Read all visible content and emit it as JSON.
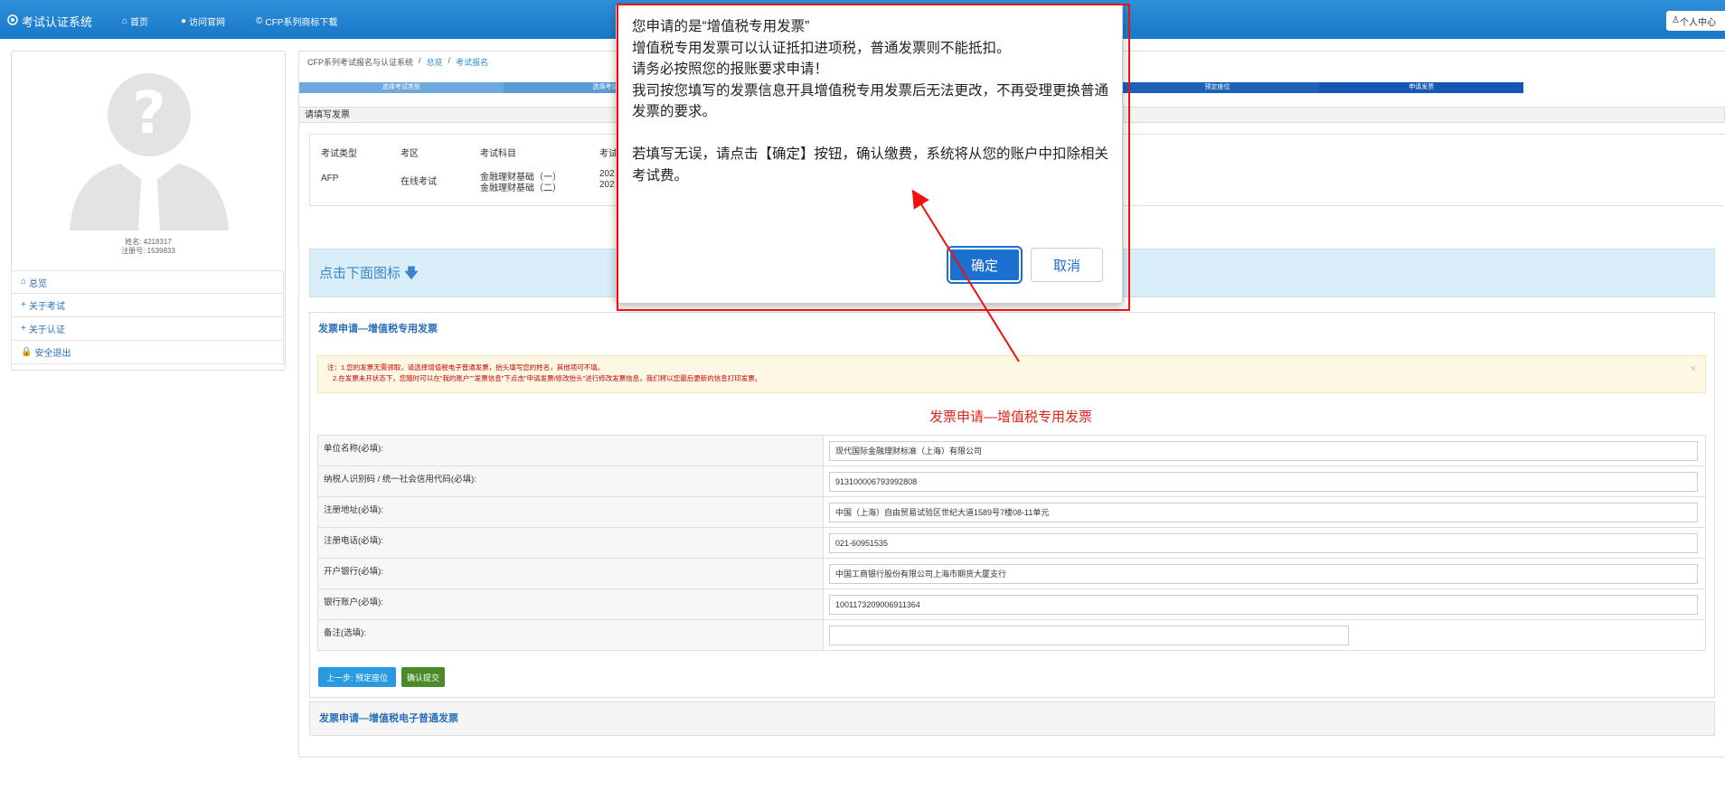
{
  "navbar": {
    "brand": "考试认证系统",
    "home": "首页",
    "official_site": "访问官网",
    "cfp_download": "CFP系列商标下载",
    "user_center": "个人中心"
  },
  "sidebar": {
    "name_line": "姓名: 4218317",
    "reg_line": "注册号: 1539833",
    "items": [
      {
        "label": "总览",
        "icon": "home-icon"
      },
      {
        "label": "关于考试",
        "icon": "plus-icon"
      },
      {
        "label": "关于认证",
        "icon": "plus-icon"
      },
      {
        "label": "安全退出",
        "icon": "lock-icon"
      }
    ]
  },
  "breadcrumb": [
    "CFP系列考试报名与认证系统",
    "总览",
    "考试报名"
  ],
  "steps": [
    {
      "label": "选择考试类型",
      "color": "#6fa8dc"
    },
    {
      "label": "选择考试",
      "color": "#5b9bd5"
    },
    {
      "label": "",
      "color": "#3c7fc9"
    },
    {
      "label": "",
      "color": "#2e72c1"
    },
    {
      "label": "预定座位",
      "color": "#1c62b9"
    },
    {
      "label": "申请发票",
      "color": "#1458b3"
    }
  ],
  "section_head": "请填写发票",
  "exam_info": {
    "headers": [
      "考试类型",
      "考区",
      "考试科目",
      "考试"
    ],
    "type": "AFP",
    "area": "在线考试",
    "subjects": [
      "金融理财基础（一）",
      "金融理财基础（二）"
    ],
    "dates": [
      "202",
      "202"
    ]
  },
  "click_banner": "点击下面图标",
  "invoice_special_title": "发票申请—增值税专用发票",
  "notice": {
    "line1": "注：1.您的发票无需领取，请选择增值税电子普通发票，抬头填写您的姓名，其他项可不填。",
    "line2": "2.在发票未开状态下，您随时可以在\"我的账户\"\"发票信息\"下点击\"申请发票/修改抬头\"进行修改发票信息，我们将以您最后更新的信息打印发票。"
  },
  "form_title": "发票申请—增值税专用发票",
  "form_rows": [
    {
      "label": "单位名称(必填):",
      "value": "现代国际金融理财标准（上海）有限公司"
    },
    {
      "label": "纳税人识别码 / 统一社会信用代码(必填):",
      "value": "913100006793992808"
    },
    {
      "label": "注册地址(必填):",
      "value": "中国（上海）自由贸易试验区世纪大道1589号7楼08-11单元"
    },
    {
      "label": "注册电话(必填):",
      "value": "021-60951535"
    },
    {
      "label": "开户银行(必填):",
      "value": "中国工商银行股份有限公司上海市期货大厦支行"
    },
    {
      "label": "银行账户(必填):",
      "value": "1001173209006911364"
    },
    {
      "label": "备注(选填):",
      "value": ""
    }
  ],
  "buttons": {
    "prev": "上一步: 预定座位",
    "submit": "确认提交"
  },
  "invoice_electronic_title": "发票申请—增值税电子普通发票",
  "modal": {
    "lines": [
      "您申请的是“增值税专用发票”",
      "增值税专用发票可以认证抵扣进项税，普通发票则不能抵扣。",
      "请务必按照您的报账要求申请！",
      "我司按您填写的发票信息开具增值税专用发票后无法更改，不再受理更换普通发票的要求。",
      "",
      "若填写无误，请点击【确定】按钮，确认缴费，系统将从您的账户中扣除相关考试费。"
    ],
    "ok": "确定",
    "cancel": "取消"
  },
  "colors": {
    "navbar": "#1878c9",
    "accent_red": "#e11",
    "ok_button": "#1a6fcf"
  }
}
